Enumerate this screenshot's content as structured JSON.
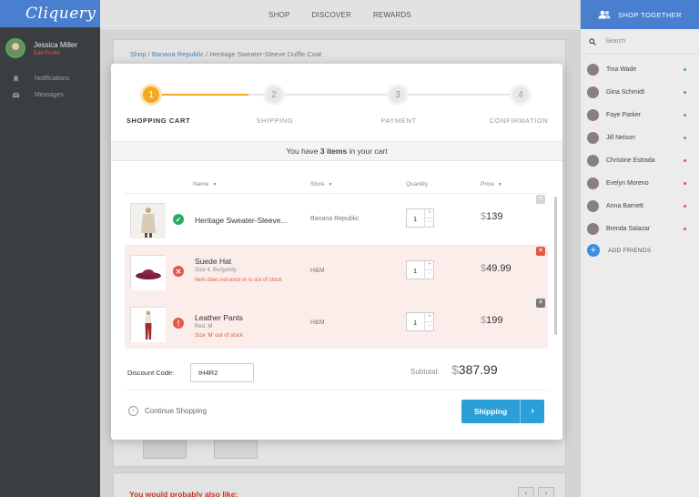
{
  "app": {
    "logo": "Cliquery"
  },
  "profile": {
    "name": "Jessica Miller",
    "edit_label": "Edit Profile"
  },
  "sidebar": {
    "items": [
      {
        "label": "Notifications"
      },
      {
        "label": "Messages"
      }
    ]
  },
  "top_nav": {
    "items": [
      {
        "label": "SHOP"
      },
      {
        "label": "DISCOVER"
      },
      {
        "label": "REWARDS"
      }
    ]
  },
  "right_panel": {
    "title": "SHOP TOGETHER",
    "search_placeholder": "Search",
    "friends": [
      {
        "name": "Tina Wade",
        "status_color": "#4caf50"
      },
      {
        "name": "Gina Schmidt",
        "status_color": "#4caf50"
      },
      {
        "name": "Faye Parker",
        "status_color": "#4caf50"
      },
      {
        "name": "Jill Nelson",
        "status_color": "#4caf50"
      },
      {
        "name": "Christine Estrada",
        "status_color": "#e05a4a"
      },
      {
        "name": "Evelyn Moreno",
        "status_color": "#e05a4a"
      },
      {
        "name": "Anna Barnett",
        "status_color": "#e05a4a"
      },
      {
        "name": "Brenda Salazar",
        "status_color": "#e05a4a"
      }
    ],
    "add_friends": "ADD FRIENDS"
  },
  "breadcrumb": {
    "shop": "Shop",
    "sep": "/",
    "store": "Banana Republic",
    "product": "Heritage Sweater-Sleeve Duffle Coat"
  },
  "background": {
    "also_like": "You would probably also like:"
  },
  "stepper": {
    "steps": [
      {
        "number": "1",
        "label": "SHOPPING CART",
        "active": true
      },
      {
        "number": "2",
        "label": "SHIPPING",
        "active": false
      },
      {
        "number": "3",
        "label": "PAYMENT",
        "active": false
      },
      {
        "number": "4",
        "label": "CONFIRMATION",
        "active": false
      }
    ],
    "accent_color": "#f5a623"
  },
  "cart": {
    "summary_prefix": "You have",
    "summary_count": "3 items",
    "summary_suffix": "in your cart",
    "columns": {
      "name": "Name",
      "store": "Store",
      "quantity": "Quantity",
      "price": "Price"
    },
    "items": [
      {
        "name": "Heritage Sweater-Sleeve...",
        "meta": "",
        "error": "",
        "store": "Banana Republic",
        "quantity": "1",
        "currency": "$",
        "price": "139",
        "status": "ok"
      },
      {
        "name": "Suede Hat",
        "meta": "Size 4, Burgundy",
        "error": "Item does not exist or is out of stock",
        "store": "H&M",
        "quantity": "1",
        "currency": "$",
        "price": "49.99",
        "status": "error"
      },
      {
        "name": "Leather Pants",
        "meta": "Red, M",
        "error": "Size 'M' out of stock",
        "store": "H&M",
        "quantity": "1",
        "currency": "$",
        "price": "199",
        "status": "warning"
      }
    ],
    "discount_label": "Discount Code:",
    "discount_value": "IH4R2",
    "subtotal_label": "Subtotal:",
    "subtotal_currency": "$",
    "subtotal_value": "387.99",
    "continue_label": "Continue Shopping",
    "next_label": "Shipping"
  }
}
